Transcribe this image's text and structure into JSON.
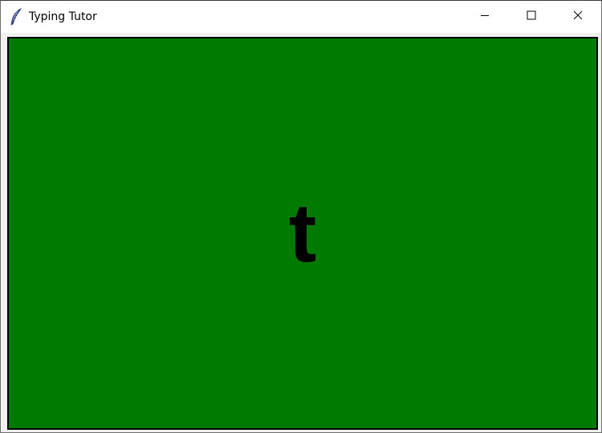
{
  "window": {
    "title": "Typing Tutor",
    "app_icon": "feather-icon",
    "controls": {
      "minimize_icon": "minimize-icon",
      "maximize_icon": "maximize-icon",
      "close_icon": "close-icon"
    }
  },
  "canvas": {
    "background_color": "#007a00",
    "border_color": "#000000",
    "current_letter": "t"
  }
}
